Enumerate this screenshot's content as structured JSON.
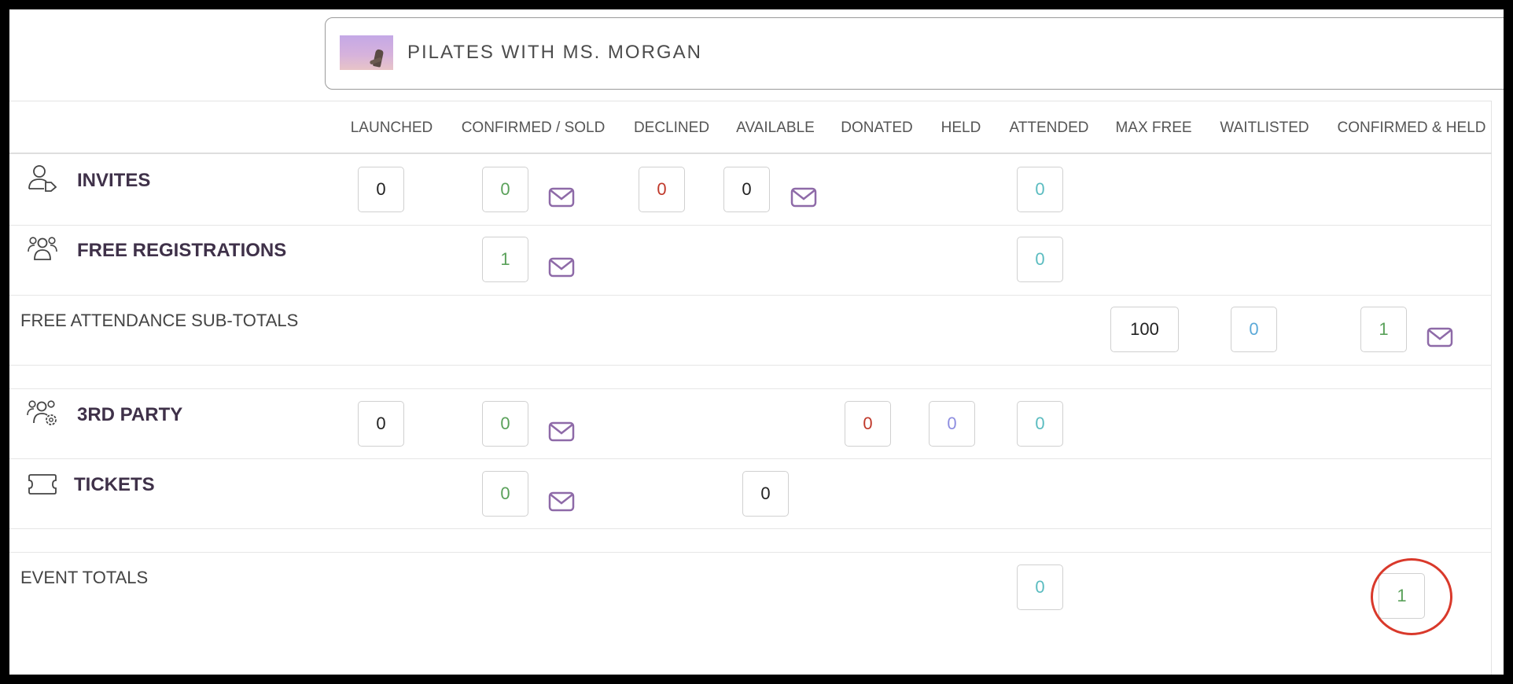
{
  "event": {
    "title": "PILATES WITH MS. MORGAN"
  },
  "columns": [
    "LAUNCHED",
    "CONFIRMED / SOLD",
    "DECLINED",
    "AVAILABLE",
    "DONATED",
    "HELD",
    "ATTENDED",
    "MAX FREE",
    "WAITLISTED",
    "CONFIRMED & HELD"
  ],
  "rows": {
    "invites": {
      "label": "INVITES",
      "icon": "user-tag-icon",
      "launched": "0",
      "confirmed": "0",
      "declined": "0",
      "available": "0",
      "attended": "0"
    },
    "free_registrations": {
      "label": "FREE REGISTRATIONS",
      "icon": "group-icon",
      "confirmed": "1",
      "attended": "0"
    },
    "free_subtotals": {
      "label": "FREE ATTENDANCE SUB-TOTALS",
      "max_free": "100",
      "waitlisted": "0",
      "confirmed_held": "1"
    },
    "third_party": {
      "label": "3RD PARTY",
      "icon": "group-settings-icon",
      "launched": "0",
      "confirmed": "0",
      "donated": "0",
      "held": "0",
      "attended": "0"
    },
    "tickets": {
      "label": "TICKETS",
      "icon": "ticket-icon",
      "confirmed": "0",
      "available": "0"
    },
    "event_totals": {
      "label": "EVENT TOTALS",
      "attended": "0",
      "confirmed_held": "1"
    }
  },
  "colors": {
    "primary_text": "#3f3149",
    "mail_icon": "#8e6aa8",
    "green": "#5aa15a",
    "red": "#c0392b",
    "teal": "#5bbcc0",
    "blue": "#5ba9d8",
    "highlight": "#d9392b"
  }
}
